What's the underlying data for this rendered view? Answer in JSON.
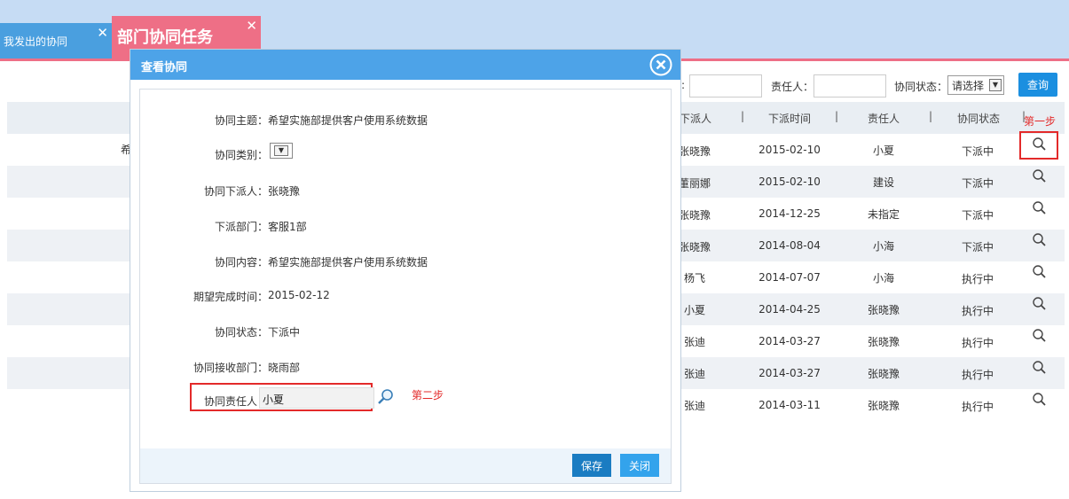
{
  "tabs": {
    "mine_label": "我发出的协同",
    "dept_label": "部门协同任务",
    "close_glyph": "✕"
  },
  "filters": {
    "assigner_tail": ":",
    "responsible_label": "责任人：",
    "status_label": "协同状态：",
    "status_value": "请选择",
    "query_button": "查询"
  },
  "table": {
    "headers": [
      "下派人",
      "下派时间",
      "责任人",
      "协同状态"
    ],
    "separator": "|",
    "first_row_fragment": "希",
    "rows": [
      {
        "assigner": "张晓豫",
        "date": "2015-02-10",
        "responsible": "小夏",
        "status": "下派中"
      },
      {
        "assigner": "董丽娜",
        "date": "2015-02-10",
        "responsible": "建设",
        "status": "下派中"
      },
      {
        "assigner": "张晓豫",
        "date": "2014-12-25",
        "responsible": "未指定",
        "status": "下派中"
      },
      {
        "assigner": "张晓豫",
        "date": "2014-08-04",
        "responsible": "小海",
        "status": "下派中"
      },
      {
        "assigner": "杨飞",
        "date": "2014-07-07",
        "responsible": "小海",
        "status": "执行中"
      },
      {
        "assigner": "小夏",
        "date": "2014-04-25",
        "responsible": "张晓豫",
        "status": "执行中"
      },
      {
        "assigner": "张迪",
        "date": "2014-03-27",
        "responsible": "张晓豫",
        "status": "执行中"
      },
      {
        "assigner": "张迪",
        "date": "2014-03-27",
        "responsible": "张晓豫",
        "status": "执行中"
      },
      {
        "assigner": "张迪",
        "date": "2014-03-11",
        "responsible": "张晓豫",
        "status": "执行中"
      }
    ]
  },
  "annotations": {
    "step1": "第一步",
    "step2": "第二步"
  },
  "modal": {
    "title": "查看协同",
    "fields": {
      "subject_label": "协同主题：",
      "subject_value": "希望实施部提供客户使用系统数据",
      "type_label": "协同类别：",
      "assigner_label": "协同下派人：",
      "assigner_value": "张晓豫",
      "dept_label": "下派部门：",
      "dept_value": "客服1部",
      "content_label": "协同内容：",
      "content_value": "希望实施部提供客户使用系统数据",
      "due_label": "期望完成时间：",
      "due_value": "2015-02-12",
      "status_label": "协同状态：",
      "status_value": "下派中",
      "recv_dept_label": "协同接收部门：",
      "recv_dept_value": "晓雨部",
      "responsible_label": "协同责任人：",
      "responsible_value": "小夏"
    },
    "save_button": "保存",
    "close_button": "关闭"
  },
  "colors": {
    "accent_blue": "#4da3e8",
    "tab_pink": "#ee6f86",
    "annotation_red": "#e32a2a"
  }
}
